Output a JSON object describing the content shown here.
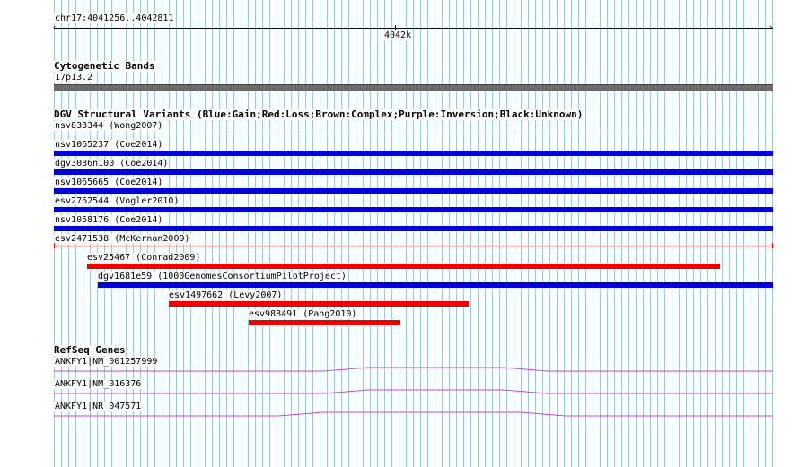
{
  "ruler": {
    "position": "chr17:4041256..4042811",
    "tick_label": "4042k"
  },
  "tracks": {
    "cyto": {
      "title": "Cytogenetic Bands",
      "band": "17p13.2"
    },
    "dgv": {
      "title": "DGV Structural Variants (Blue:Gain;Red:Loss;Brown:Complex;Purple:Inversion;Black:Unknown)",
      "features": [
        {
          "label": "nsv833344 (Wong2007)",
          "color": "#1f1fa8",
          "thin": true
        },
        {
          "label": "nsv1065237 (Coe2014)",
          "color": "#0000dd"
        },
        {
          "label": "dgv3086n100 (Coe2014)",
          "color": "#0000dd"
        },
        {
          "label": "nsv1065665 (Coe2014)",
          "color": "#0000dd"
        },
        {
          "label": "esv2762544 (Vogler2010)",
          "color": "#0000dd"
        },
        {
          "label": "nsv1058176 (Coe2014)",
          "color": "#0000dd"
        },
        {
          "label": "esv2471538 (McKernan2009)",
          "color": "#ee0000",
          "thin": true
        },
        {
          "label": "esv25467 (Conrad2009)",
          "color": "#ee0000"
        },
        {
          "label": "dgv1681e59 (1000GenomesConsortiumPilotProject)",
          "color": "#0000dd"
        },
        {
          "label": "esv1497662 (Levy2007)",
          "color": "#ee0000"
        },
        {
          "label": "esv988491 (Pang2010)",
          "color": "#ee0000"
        }
      ]
    },
    "refseq": {
      "title": "RefSeq Genes",
      "genes": [
        {
          "label": "ANKFY1|NM_001257999",
          "color": "#cc44cc"
        },
        {
          "label": "ANKFY1|NM_016376",
          "color": "#cc44cc"
        },
        {
          "label": "ANKFY1|NR_047571",
          "color": "#cc44cc"
        }
      ]
    }
  }
}
